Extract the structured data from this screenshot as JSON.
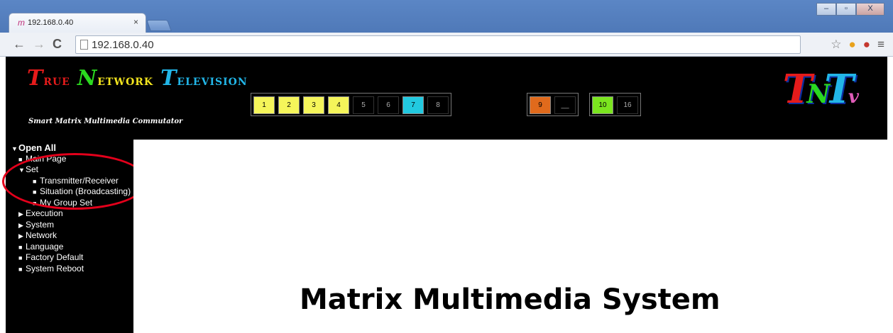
{
  "browser": {
    "tab_favicon": "m",
    "tab_title": "192.168.0.40",
    "tab_close": "×",
    "url": "192.168.0.40",
    "window_buttons": [
      "–",
      "▫",
      "X"
    ]
  },
  "header": {
    "logo_words": [
      {
        "initial": "T",
        "rest": "RUE",
        "initial_color": "#e61b1b",
        "rest_color": "#e61b1b"
      },
      {
        "initial": "N",
        "rest": "ETWORK",
        "initial_color": "#2bd91f",
        "rest_color": "#f2e41f"
      },
      {
        "initial": "T",
        "rest": "ELEVISION",
        "initial_color": "#22b6e8",
        "rest_color": "#22b6e8"
      }
    ],
    "tagline": "Smart Matrix Multimedia Commutator",
    "channel_buttons": [
      {
        "label": "1",
        "color": "#f5f55a"
      },
      {
        "label": "2",
        "color": "#f5f55a"
      },
      {
        "label": "3",
        "color": "#f5f55a"
      },
      {
        "label": "4",
        "color": "#f5f55a"
      },
      {
        "label": "5",
        "color": "#000000"
      },
      {
        "label": "6",
        "color": "#000000"
      },
      {
        "label": "7",
        "color": "#22c9e0"
      },
      {
        "label": "8",
        "color": "#000000"
      }
    ],
    "group2_buttons": [
      {
        "label": "9",
        "color": "#e06a1c"
      },
      {
        "label": "__",
        "color": "#000000"
      }
    ],
    "group3_buttons": [
      {
        "label": "10",
        "color": "#7be51f"
      },
      {
        "label": "16",
        "color": "#000000"
      }
    ],
    "brand": {
      "t1": "T",
      "n": "N",
      "t2": "T",
      "v": "v"
    }
  },
  "sidebar": {
    "items": [
      {
        "label": "Open All",
        "mark": "▼",
        "level": 0,
        "bold": true
      },
      {
        "label": "Main Page",
        "mark": "■",
        "level": 1
      },
      {
        "label": "Set",
        "mark": "▼",
        "level": 1
      },
      {
        "label": "Transmitter/Receiver",
        "mark": "■",
        "level": 2
      },
      {
        "label": "Situation (Broadcasting)",
        "mark": "■",
        "level": 2
      },
      {
        "label": "My Group Set",
        "mark": "■",
        "level": 2
      },
      {
        "label": "Execution",
        "mark": "▶",
        "level": 1
      },
      {
        "label": "System",
        "mark": "▶",
        "level": 1
      },
      {
        "label": "Network",
        "mark": "▶",
        "level": 1
      },
      {
        "label": "Language",
        "mark": "■",
        "level": 1
      },
      {
        "label": "Factory Default",
        "mark": "■",
        "level": 1
      },
      {
        "label": "System Reboot",
        "mark": "■",
        "level": 1
      }
    ]
  },
  "main": {
    "title": "Matrix Multimedia System"
  }
}
